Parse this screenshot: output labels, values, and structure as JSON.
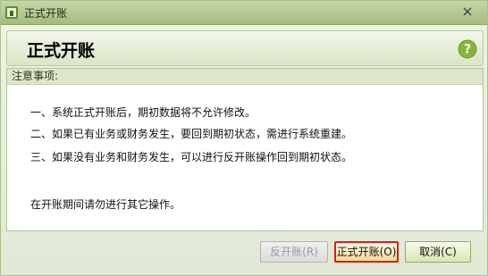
{
  "window": {
    "title": "正式开账",
    "close_icon": "close-icon",
    "app_icon": "app-icon"
  },
  "header": {
    "title": "正式开账",
    "help_icon": "help-icon",
    "accent": "#84b63b"
  },
  "notes": {
    "title": "注意事项:",
    "items": [
      "一、系统正式开账后，期初数据将不允许修改。",
      "二、如果已有业务或财务发生，要回到期初状态，需进行系统重建。",
      "三、如果没有业务和财务发生，可以进行反开账操作回到期初状态。"
    ],
    "footer": "在开账期间请勿进行其它操作。"
  },
  "buttons": {
    "reverse": "反开账(R)",
    "confirm": "正式开账(O)",
    "cancel": "取消(C)"
  }
}
